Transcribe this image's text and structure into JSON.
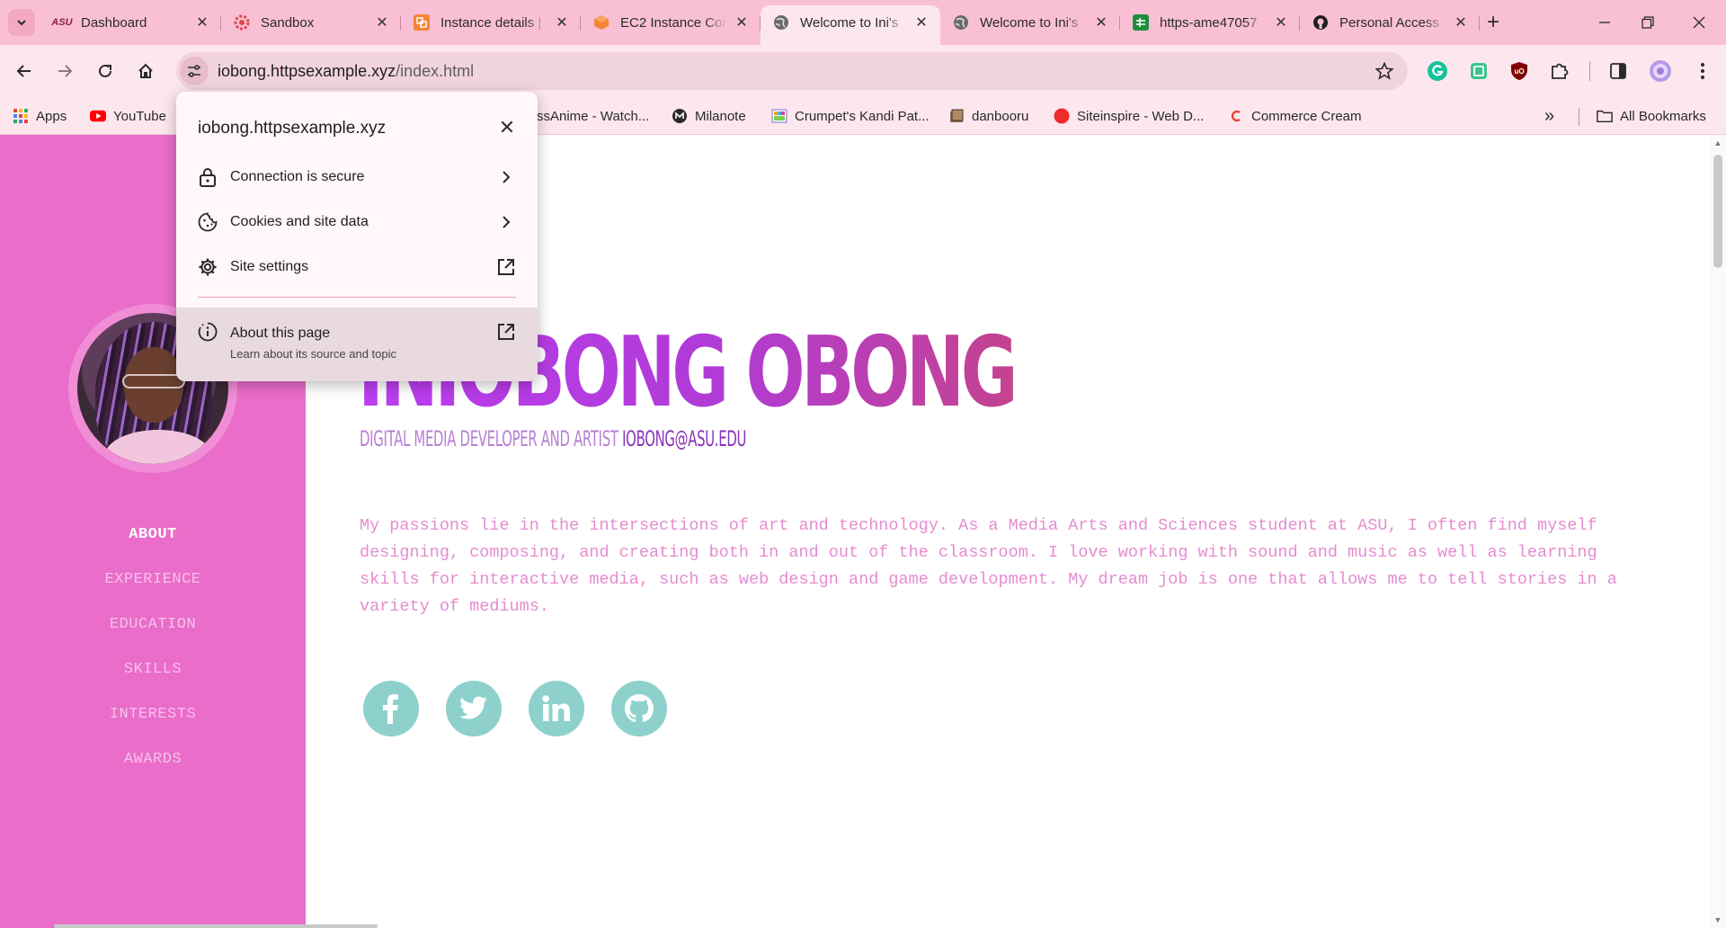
{
  "browser": {
    "tabs": [
      {
        "title": "Dashboard",
        "favicon": "asu-icon",
        "favicon_text": "ASU",
        "color": "#8c1d40",
        "active": false
      },
      {
        "title": "Sandbox",
        "favicon": "sandbox-gear-icon",
        "favicon_text": "",
        "color": "#e0474c",
        "active": false
      },
      {
        "title": "Instance details |",
        "favicon": "aws-icon",
        "favicon_text": "",
        "color": "#f58536",
        "active": false
      },
      {
        "title": "EC2 Instance Cor",
        "favicon": "ec2-icon",
        "favicon_text": "",
        "color": "#f58536",
        "active": false
      },
      {
        "title": "Welcome to Ini's",
        "favicon": "globe-icon",
        "favicon_text": "",
        "color": "#5f5f5f",
        "active": true
      },
      {
        "title": "Welcome to Ini's",
        "favicon": "globe-icon",
        "favicon_text": "",
        "color": "#5f5f5f",
        "active": false
      },
      {
        "title": "https-ame47057",
        "favicon": "sheets-icon",
        "favicon_text": "",
        "color": "#1e8e3e",
        "active": false
      },
      {
        "title": "Personal Access",
        "favicon": "github-icon",
        "favicon_text": "",
        "color": "#1f1f1f",
        "active": false
      }
    ],
    "close_glyph": "✕",
    "new_tab_glyph": "+",
    "omnibox": {
      "domain": "iobong.httpsexample.xyz",
      "path": "/index.html"
    },
    "bookmarks": [
      {
        "label": "Apps",
        "icon": "apps-grid-icon"
      },
      {
        "label": "YouTube",
        "icon": "youtube-icon"
      },
      {
        "label": "ssAnime - Watch...",
        "icon": "none"
      },
      {
        "label": "Milanote",
        "icon": "milanote-icon"
      },
      {
        "label": "Crumpet's Kandi Pat...",
        "icon": "kandi-icon"
      },
      {
        "label": "danbooru",
        "icon": "danbooru-icon"
      },
      {
        "label": "Siteinspire - Web D...",
        "icon": "siteinspire-icon"
      },
      {
        "label": "Commerce Cream",
        "icon": "commerce-cream-icon"
      }
    ],
    "bookmarks_overflow": "»",
    "all_bookmarks": "All Bookmarks"
  },
  "site_popup": {
    "domain": "iobong.httpsexample.xyz",
    "close_glyph": "✕",
    "rows": [
      {
        "label": "Connection is secure",
        "icon": "lock-icon",
        "trail": "chevron-right-icon"
      },
      {
        "label": "Cookies and site data",
        "icon": "cookie-icon",
        "trail": "chevron-right-icon"
      },
      {
        "label": "Site settings",
        "icon": "gear-icon",
        "trail": "external-link-icon"
      }
    ],
    "about": {
      "label": "About this page",
      "sub": "Learn about its source and topic",
      "icon": "info-icon",
      "trail": "external-link-icon"
    }
  },
  "page": {
    "nav": [
      "ABOUT",
      "EXPERIENCE",
      "EDUCATION",
      "SKILLS",
      "INTERESTS",
      "AWARDS"
    ],
    "name": "INIOBONG OBONG",
    "role": "DIGITAL MEDIA DEVELOPER AND ARTIST",
    "email": "IOBONG@ASU.EDU",
    "bio": "My passions lie in the intersections of art and technology. As a Media Arts and Sciences student at ASU, I often find myself designing, composing, and creating both in and out of the classroom. I love working with sound and music as well as learning skills for interactive media, such as web design and game development. My dream job is one that allows me to tell stories in a variety of mediums.",
    "social": [
      "facebook-icon",
      "twitter-icon",
      "linkedin-icon",
      "github-icon"
    ],
    "colors": {
      "sidebar": "#e96dc9",
      "name_gradient_start": "#bb3df0",
      "name_gradient_end": "#c4438f",
      "bio": "#e58cd0",
      "social": "#8ed1cc"
    }
  }
}
